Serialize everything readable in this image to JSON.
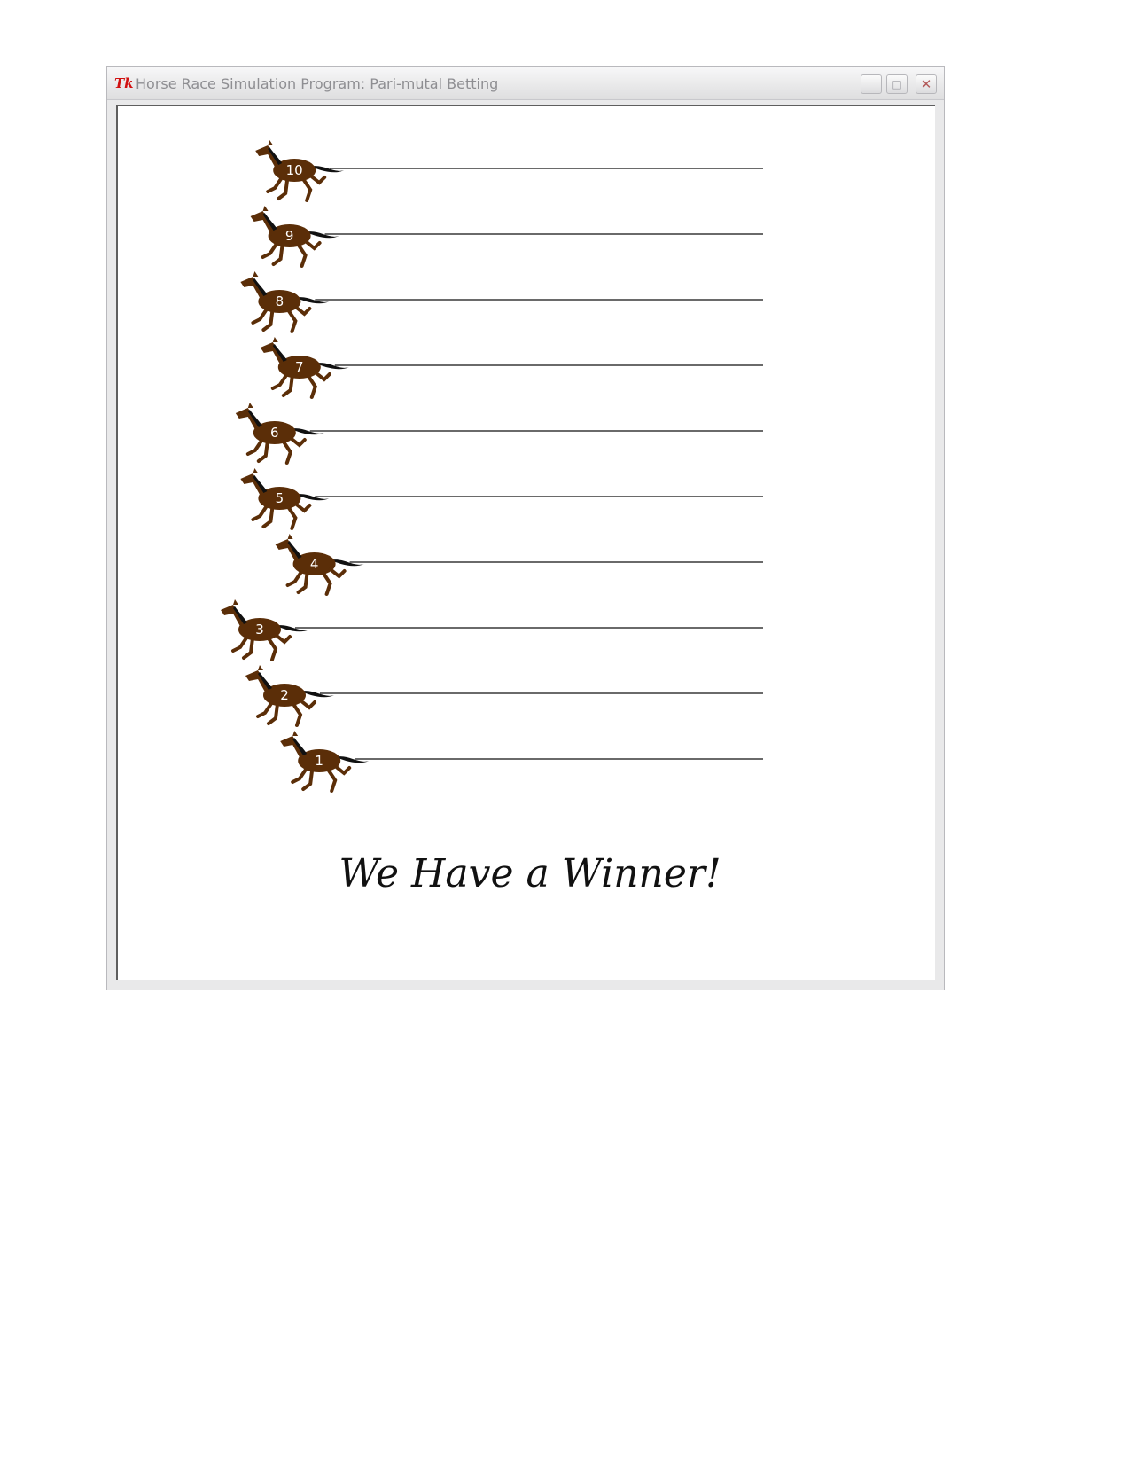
{
  "window": {
    "title": "Horse Race Simulation Program: Pari-mutal Betting",
    "icon": "tk-icon",
    "buttons": {
      "minimize": "_",
      "maximize": "□",
      "close": "✕"
    }
  },
  "race": {
    "horses": [
      {
        "number": "10",
        "progress": 0.07
      },
      {
        "number": "9",
        "progress": 0.06
      },
      {
        "number": "8",
        "progress": 0.04
      },
      {
        "number": "7",
        "progress": 0.08
      },
      {
        "number": "6",
        "progress": 0.03
      },
      {
        "number": "5",
        "progress": 0.04
      },
      {
        "number": "4",
        "progress": 0.11
      },
      {
        "number": "3",
        "progress": 0.0
      },
      {
        "number": "2",
        "progress": 0.05
      },
      {
        "number": "1",
        "progress": 0.12
      }
    ],
    "horse_color": "#5b2e08",
    "mane_color": "#111111"
  },
  "message": "We Have a Winner!"
}
